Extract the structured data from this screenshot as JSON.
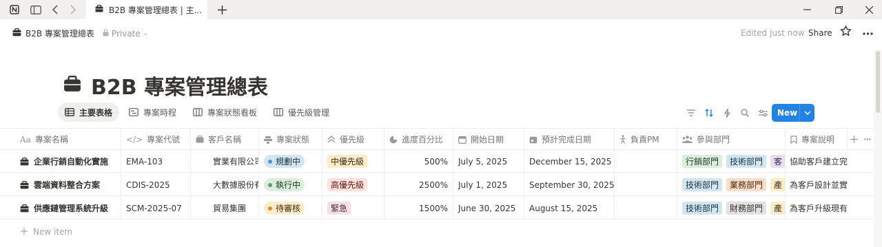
{
  "browser": {
    "tab_title": "B2B 專案管理總表 | 主..."
  },
  "topbar": {
    "breadcrumb": "B2B 專案管理總表",
    "privacy": "Private",
    "edited": "Edited just now",
    "share": "Share"
  },
  "page": {
    "title": "B2B 專案管理總表"
  },
  "views": [
    {
      "label": "主要表格",
      "icon": "table-icon",
      "active": true
    },
    {
      "label": "專案時程",
      "icon": "timeline-icon",
      "active": false
    },
    {
      "label": "專案狀態看板",
      "icon": "board-icon",
      "active": false
    },
    {
      "label": "優先級管理",
      "icon": "board-icon",
      "active": false
    }
  ],
  "toolbar": {
    "new_label": "New"
  },
  "table": {
    "headers": {
      "name": "專案名稱",
      "code": "專案代號",
      "client": "客戶名稱",
      "status": "專案狀態",
      "priority": "優先級",
      "progress": "進度百分比",
      "start": "開始日期",
      "due": "預計完成日期",
      "pm": "負責PM",
      "depts": "參與部門",
      "desc": "專案說明"
    },
    "rows": [
      {
        "name": "企業行銷自動化實施",
        "code": "EMA-103",
        "client": "實業有限公司",
        "status": "規劃中",
        "priority": "中優先級",
        "progress": "500%",
        "start": "July 5, 2025",
        "due": "December 15, 2025",
        "pm": "",
        "depts": [
          "行銷部門",
          "技術部門",
          "客"
        ],
        "desc": "協助客戶建立完"
      },
      {
        "name": "雲端資料整合方案",
        "code": "CDIS-2025",
        "client": "大數據股份有",
        "status": "執行中",
        "priority": "高優先級",
        "progress": "2500%",
        "start": "July 1, 2025",
        "due": "September 30, 2025",
        "pm": "",
        "depts": [
          "技術部門",
          "業務部門",
          "產"
        ],
        "desc": "為客戶設計並實"
      },
      {
        "name": "供應鏈管理系統升級",
        "code": "SCM-2025-07",
        "client": "貿易集團",
        "status": "待審核",
        "priority": "緊急",
        "progress": "1500%",
        "start": "June 30, 2025",
        "due": "August 15, 2025",
        "pm": "",
        "depts": [
          "技術部門",
          "財務部門",
          "產"
        ],
        "desc": "為客戶升級現有"
      }
    ],
    "new_item": "New item"
  },
  "colors": {
    "accent": "#2383e2",
    "status_planning_bg": "#d3e5ef",
    "status_planning_dot": "#5b97bd",
    "status_running_bg": "#dbeddb",
    "status_running_dot": "#6c9b7d",
    "status_review_bg": "#fdecc8",
    "status_review_dot": "#cb9433",
    "prio_mid_bg": "#fdecc8",
    "prio_high_bg": "#ffe2dd",
    "prio_urgent_bg": "#f5e0e9"
  }
}
